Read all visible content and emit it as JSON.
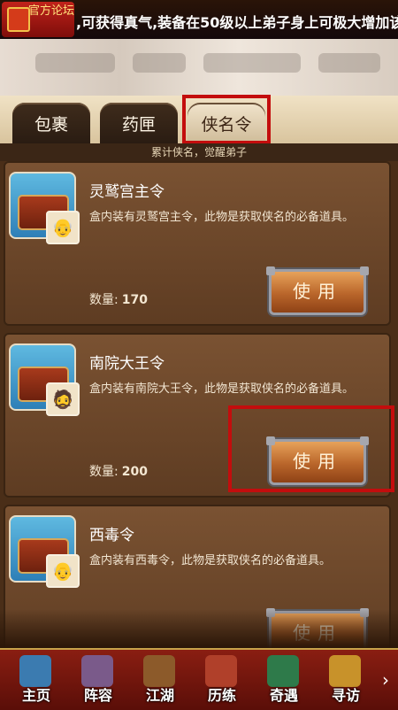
{
  "banner": {
    "logo_text": "官方论坛",
    "marquee": ",可获得真气,装备在50级以上弟子身上可极大增加该"
  },
  "tabs": [
    {
      "label": "包裹",
      "active": false
    },
    {
      "label": "药匣",
      "active": false
    },
    {
      "label": "侠名令",
      "active": true
    }
  ],
  "subtitle": "累计侠名，觉醒弟子",
  "items": [
    {
      "name": "灵鹫宫主令",
      "desc": "盒内装有灵鹫宫主令，此物是获取侠名的必备道具。",
      "qty_label": "数量:",
      "qty": "170",
      "button": "使用",
      "portrait": "👴"
    },
    {
      "name": "南院大王令",
      "desc": "盒内装有南院大王令，此物是获取侠名的必备道具。",
      "qty_label": "数量:",
      "qty": "200",
      "button": "使用",
      "portrait": "🧔"
    },
    {
      "name": "西毒令",
      "desc": "盒内装有西毒令，此物是获取侠名的必备道具。",
      "qty_label": "",
      "qty": "",
      "button": "使用",
      "portrait": "👴"
    }
  ],
  "nav": [
    {
      "label": "主页",
      "icon": "home-icon",
      "color": "#3b7bb0"
    },
    {
      "label": "阵容",
      "icon": "formation-icon",
      "color": "#7a5a8a"
    },
    {
      "label": "江湖",
      "icon": "sword-icon",
      "color": "#8c5a2a"
    },
    {
      "label": "历练",
      "icon": "training-icon",
      "color": "#b0402a"
    },
    {
      "label": "奇遇",
      "icon": "mountain-icon",
      "color": "#2e7a4a"
    },
    {
      "label": "寻访",
      "icon": "ingot-icon",
      "color": "#c8922a"
    }
  ],
  "colors": {
    "highlight": "#c30d0d",
    "nav_bg": "#8a1e12"
  }
}
